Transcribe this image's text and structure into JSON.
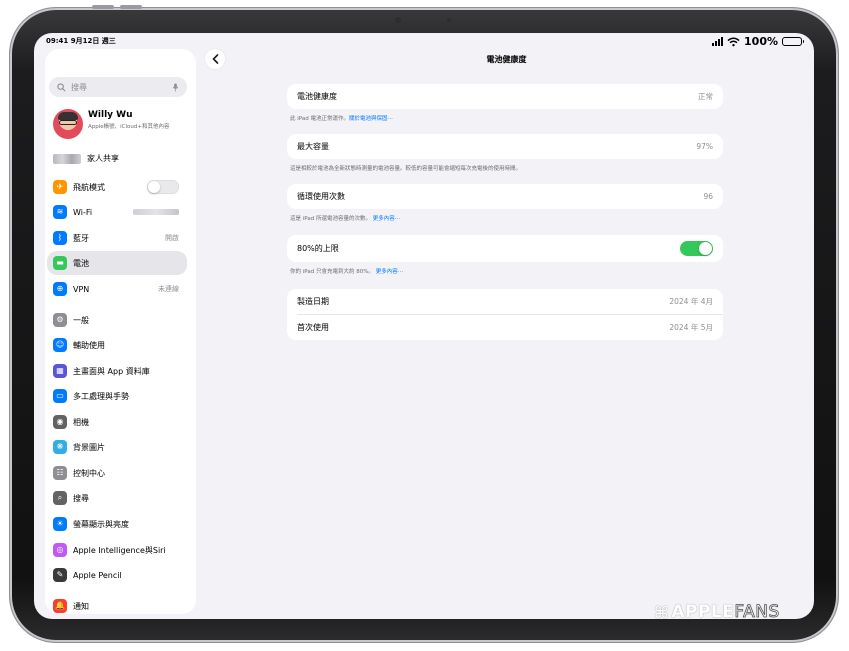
{
  "status_bar": {
    "time": "09:41  9月12日 週三",
    "battery_text": "100%"
  },
  "sidebar": {
    "search_placeholder": "搜尋",
    "profile": {
      "name": "Willy Wu",
      "subtitle": "Apple帳號、iCloud+和其他內容"
    },
    "family_sharing": "家人共享",
    "items": [
      {
        "label": "飛航模式",
        "icon": "airplane-icon",
        "color": "#ff9500",
        "glyph": "✈",
        "control": "toggle-off"
      },
      {
        "label": "Wi-Fi",
        "icon": "wifi-icon",
        "color": "#007aff",
        "glyph": "≋",
        "control": "blurred"
      },
      {
        "label": "藍牙",
        "icon": "bluetooth-icon",
        "color": "#007aff",
        "glyph": "ᛒ",
        "value": "開啟"
      },
      {
        "label": "電池",
        "icon": "battery-icon",
        "color": "#34c759",
        "glyph": "▬",
        "active": true
      },
      {
        "label": "VPN",
        "icon": "vpn-globe-icon",
        "color": "#007aff",
        "glyph": "⊕",
        "value": "未連線"
      },
      {
        "label": "一般",
        "icon": "gear-icon",
        "color": "#8e8e93",
        "glyph": "⚙"
      },
      {
        "label": "輔助使用",
        "icon": "accessibility-icon",
        "color": "#007aff",
        "glyph": "☺"
      },
      {
        "label": "主畫面與 App 資料庫",
        "icon": "home-screen-icon",
        "color": "#5856d6",
        "glyph": "▦"
      },
      {
        "label": "多工處理與手勢",
        "icon": "multitasking-icon",
        "color": "#007aff",
        "glyph": "▭"
      },
      {
        "label": "相機",
        "icon": "camera-icon",
        "color": "#636366",
        "glyph": "◉"
      },
      {
        "label": "背景圖片",
        "icon": "wallpaper-icon",
        "color": "#32ade6",
        "glyph": "❋"
      },
      {
        "label": "控制中心",
        "icon": "control-center-icon",
        "color": "#8e8e93",
        "glyph": "☷"
      },
      {
        "label": "搜尋",
        "icon": "search-icon",
        "color": "#636366",
        "glyph": "⌕"
      },
      {
        "label": "螢幕顯示與亮度",
        "icon": "brightness-icon",
        "color": "#007aff",
        "glyph": "☀"
      },
      {
        "label": "Apple Intelligence與Siri",
        "icon": "siri-icon",
        "color": "#bf5af2",
        "glyph": "◎"
      },
      {
        "label": "Apple Pencil",
        "icon": "pencil-icon",
        "color": "#3a3a3c",
        "glyph": "✎"
      },
      {
        "label": "通知",
        "icon": "notification-icon",
        "color": "#ff3b30",
        "glyph": "🔔"
      }
    ]
  },
  "main": {
    "title": "電池健康度",
    "health": {
      "label": "電池健康度",
      "value": "正常",
      "footnote": "此 iPad 電池正常運作。",
      "footnote_link": "關於電池與保固⋯"
    },
    "capacity": {
      "label": "最大容量",
      "value": "97%",
      "footnote": "這是相較於電池為全新狀態時測量的電池容量。較低的容量可能會縮短每次充電後的使用時間。"
    },
    "cycles": {
      "label": "循環使用次數",
      "value": "96",
      "footnote": "這是 iPad 所還電池容量的次數。",
      "footnote_link": "更多內容⋯"
    },
    "limit": {
      "label": "80%的上限",
      "enabled": true,
      "footnote": "你的 iPad 只會充電到大約 80%。",
      "footnote_link": "更多內容⋯"
    },
    "dates": [
      {
        "label": "製造日期",
        "value": "2024 年 4月"
      },
      {
        "label": "首次使用",
        "value": "2024 年 5月"
      }
    ]
  },
  "watermark": {
    "part1": "APPLE",
    "part2": "FANS"
  }
}
